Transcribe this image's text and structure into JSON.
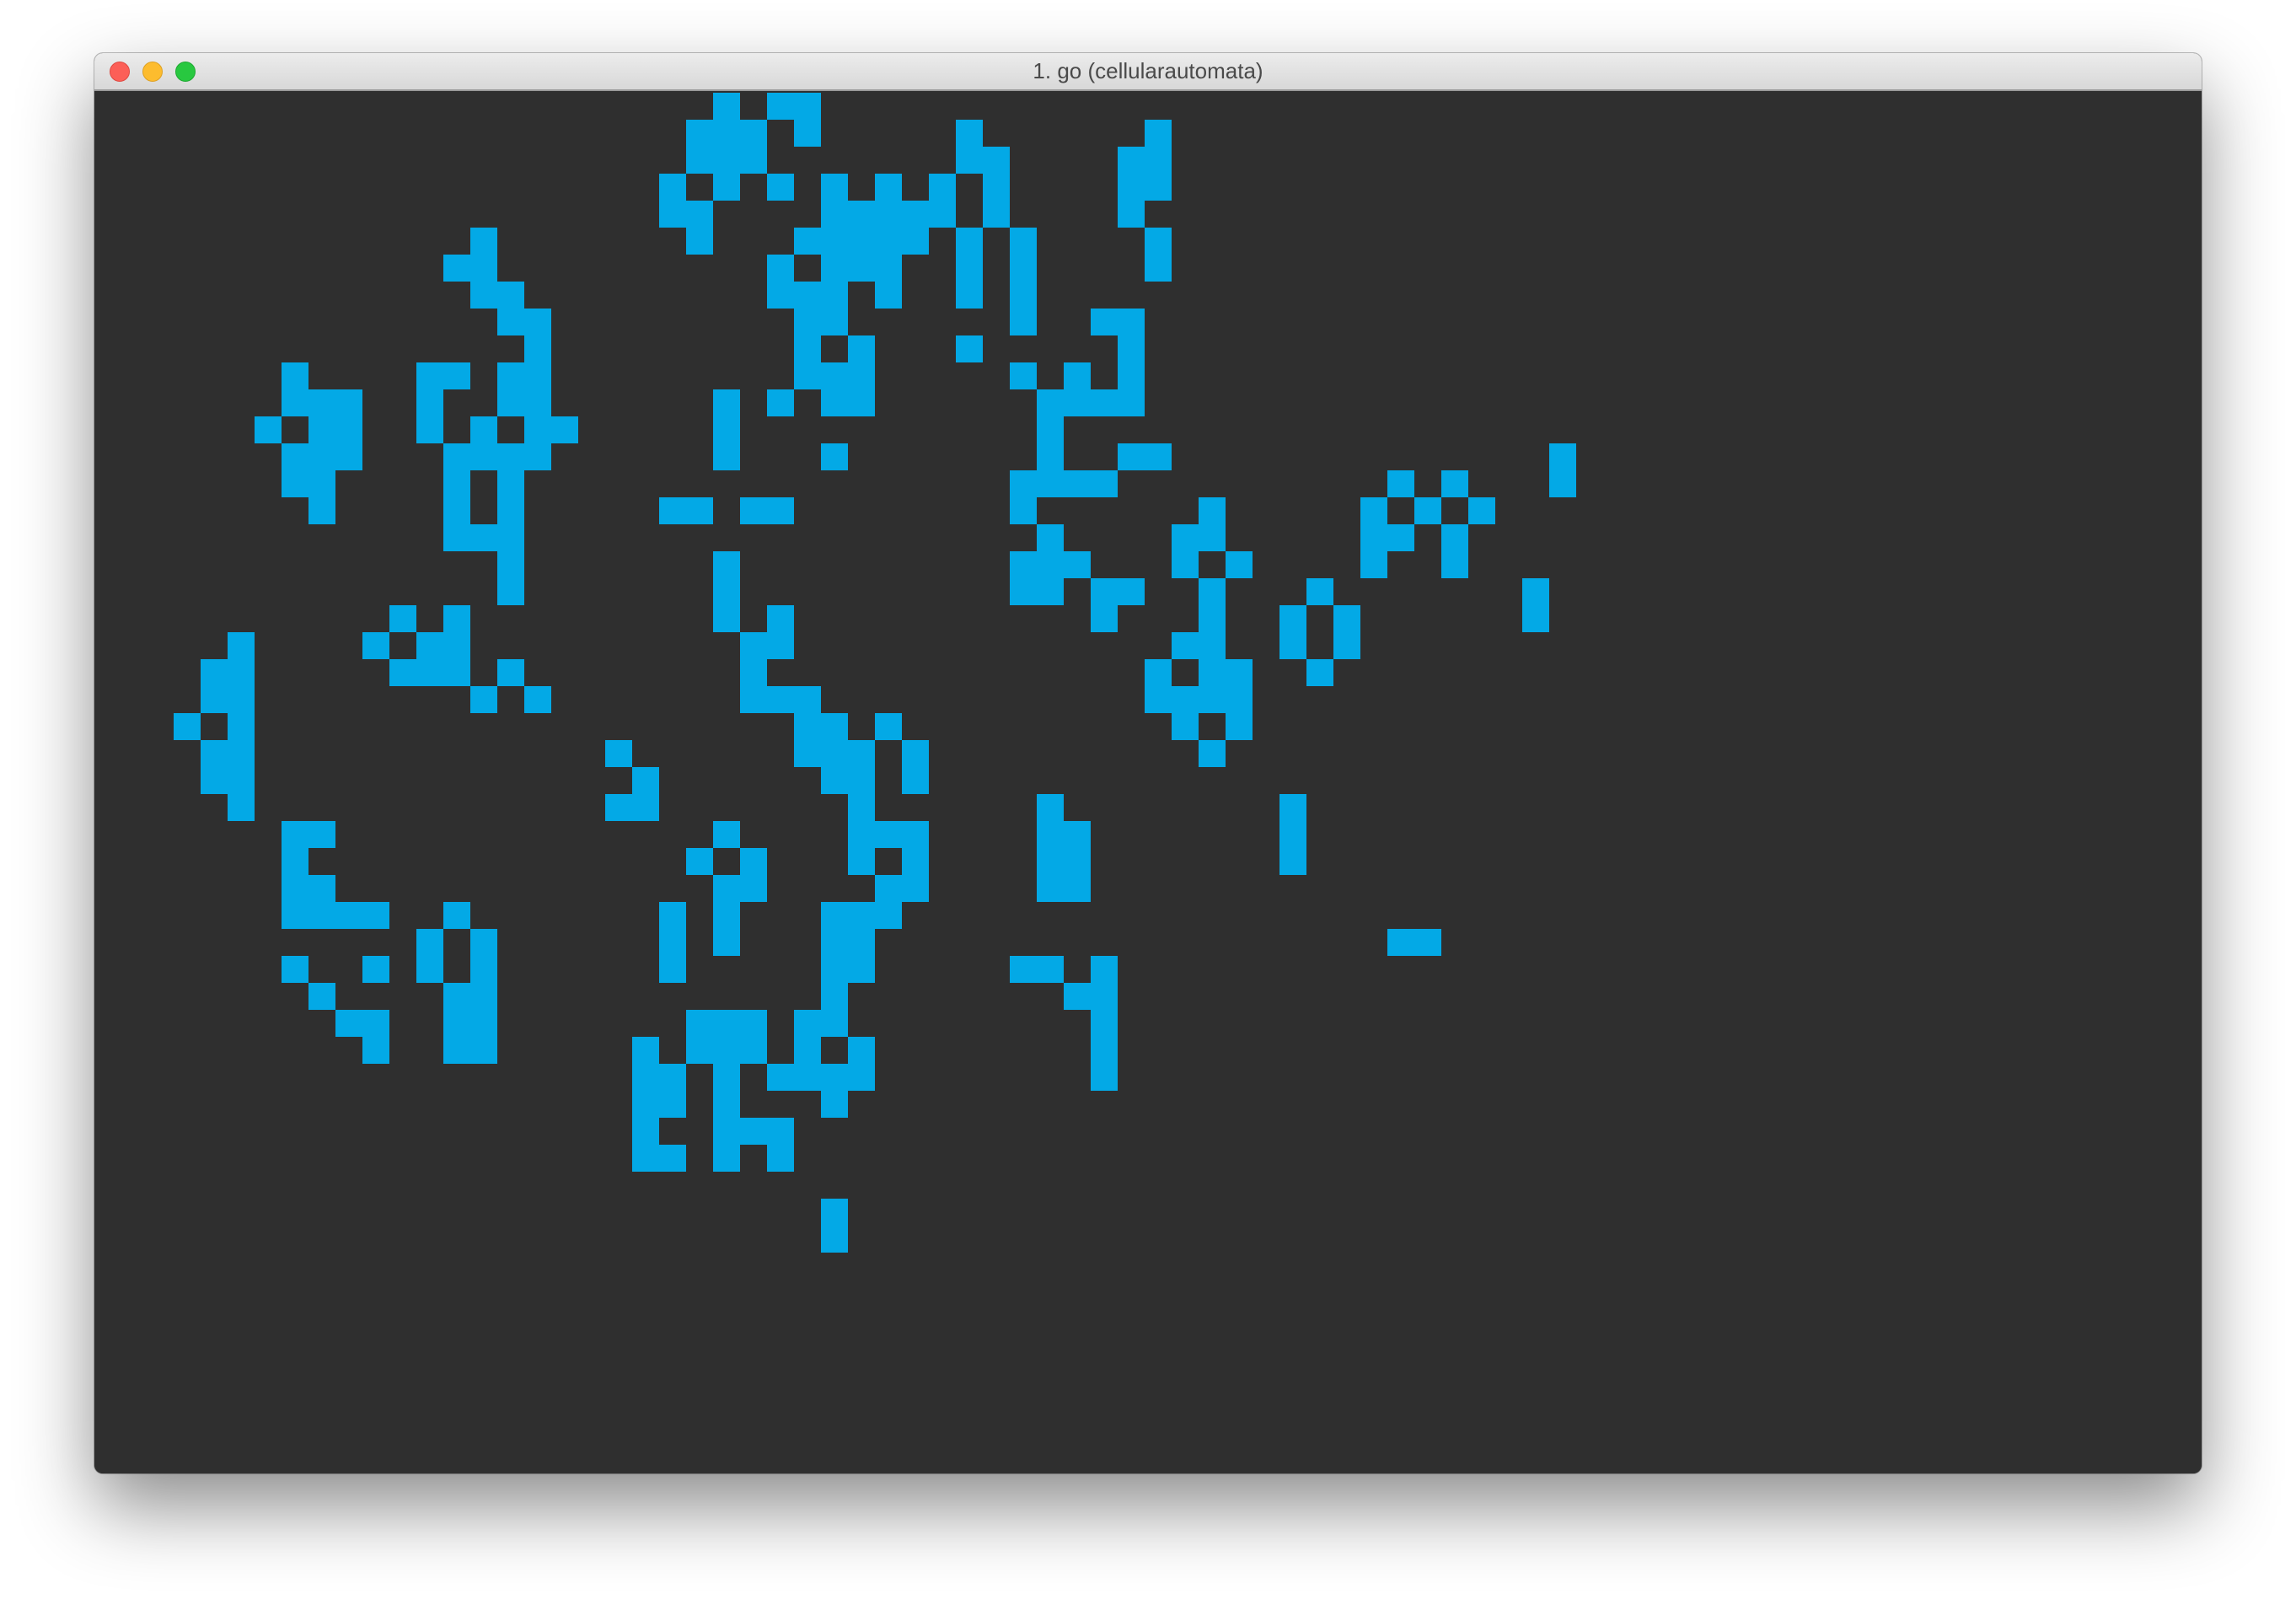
{
  "window": {
    "title": "1. go (cellularautomata)"
  },
  "colors": {
    "background": "#2f2f2f",
    "cell": "#03a9e6",
    "titlebar": "#e0e0e0"
  },
  "icons": [
    "close-button",
    "minimize-button",
    "zoom-button"
  ]
}
